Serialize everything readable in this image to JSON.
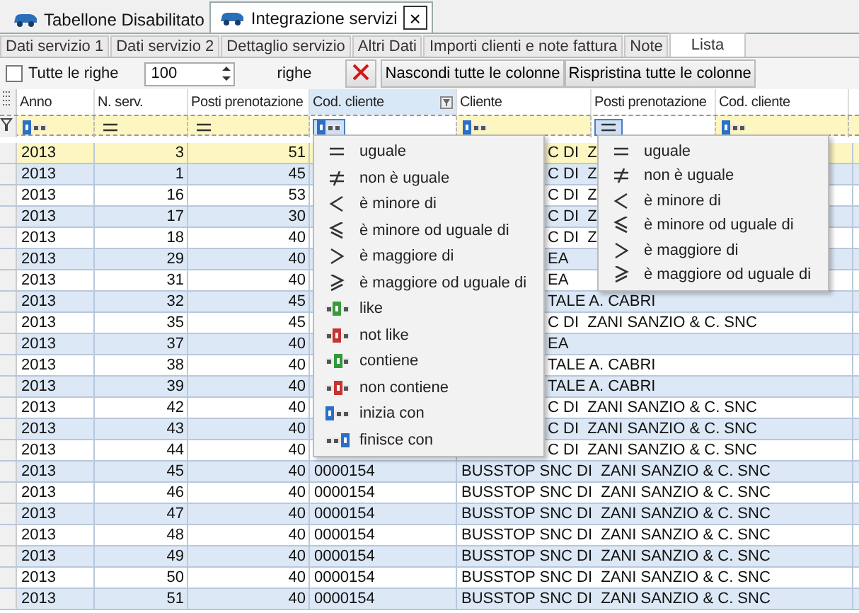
{
  "doc_tabs": [
    {
      "label": "Tabellone Disabilitato",
      "selected": false
    },
    {
      "label": "Integrazione servizi",
      "selected": true,
      "close": "×"
    }
  ],
  "sub_tabs": [
    {
      "label": "Dati servizio 1",
      "selected": false
    },
    {
      "label": "Dati servizio 2",
      "selected": false
    },
    {
      "label": "Dettaglio servizio",
      "selected": false
    },
    {
      "label": "Altri Dati",
      "selected": false
    },
    {
      "label": "Importi clienti e note fattura",
      "selected": false
    },
    {
      "label": "Note",
      "selected": false
    },
    {
      "label": "Lista",
      "selected": true
    }
  ],
  "toolbar": {
    "all_rows": {
      "label": "Tutte le righe",
      "checked": false
    },
    "count": "100",
    "count_unit": "righe",
    "hide_all": "Nascondi tutte le colonne",
    "restore_all": "Rispristina tutte le colonne"
  },
  "columns": [
    {
      "label": "Anno",
      "selected": false,
      "filter": {
        "kind": "starts_with",
        "active": false
      }
    },
    {
      "label": "N. serv.",
      "selected": false,
      "filter": {
        "kind": "equals",
        "active": false
      }
    },
    {
      "label": "Posti prenotazione",
      "selected": false,
      "filter": {
        "kind": "equals",
        "active": false
      }
    },
    {
      "label": "Cod. cliente",
      "selected": true,
      "filter": {
        "kind": "starts_with",
        "active": true
      }
    },
    {
      "label": "Cliente",
      "selected": false,
      "filter": {
        "kind": "starts_with",
        "active": false
      }
    },
    {
      "label": "Posti prenotazione",
      "selected": false,
      "filter": {
        "kind": "equals",
        "active": true
      }
    },
    {
      "label": "Cod. cliente",
      "selected": false,
      "filter": {
        "kind": "starts_with",
        "active": false
      }
    }
  ],
  "rows": [
    {
      "anno": "2013",
      "n_serv": "3",
      "posti": "51",
      "cliente": "C DI  Z",
      "cliente_cut": true,
      "selected": true
    },
    {
      "anno": "2013",
      "n_serv": "1",
      "posti": "45",
      "cliente": "C DI  Z",
      "cliente_cut": true,
      "selected": false
    },
    {
      "anno": "2013",
      "n_serv": "16",
      "posti": "53",
      "cliente": "C DI  Z",
      "cliente_cut": true,
      "selected": false
    },
    {
      "anno": "2013",
      "n_serv": "17",
      "posti": "30",
      "cliente": "C DI  Z",
      "cliente_cut": true,
      "selected": false
    },
    {
      "anno": "2013",
      "n_serv": "18",
      "posti": "40",
      "cliente": "C DI  Z",
      "cliente_cut": true,
      "selected": false
    },
    {
      "anno": "2013",
      "n_serv": "29",
      "posti": "40",
      "cliente": "EA",
      "cliente_cut": true,
      "selected": false
    },
    {
      "anno": "2013",
      "n_serv": "31",
      "posti": "40",
      "cliente": "EA",
      "cliente_cut": true,
      "selected": false
    },
    {
      "anno": "2013",
      "n_serv": "32",
      "posti": "45",
      "cliente": "TALE A. CABRI",
      "cliente_cut": true,
      "selected": false
    },
    {
      "anno": "2013",
      "n_serv": "35",
      "posti": "45",
      "cliente": "C DI  ZANI SANZIO & C. SNC",
      "cliente_cut": true,
      "selected": false
    },
    {
      "anno": "2013",
      "n_serv": "37",
      "posti": "40",
      "cliente": "EA",
      "cliente_cut": true,
      "selected": false
    },
    {
      "anno": "2013",
      "n_serv": "38",
      "posti": "40",
      "cliente": "TALE A. CABRI",
      "cliente_cut": true,
      "selected": false
    },
    {
      "anno": "2013",
      "n_serv": "39",
      "posti": "40",
      "cliente": "TALE A. CABRI",
      "cliente_cut": true,
      "selected": false
    },
    {
      "anno": "2013",
      "n_serv": "42",
      "posti": "40",
      "cliente": "C DI  ZANI SANZIO & C. SNC",
      "cliente_cut": true,
      "selected": false
    },
    {
      "anno": "2013",
      "n_serv": "43",
      "posti": "40",
      "cliente": "C DI  ZANI SANZIO & C. SNC",
      "cliente_cut": true,
      "selected": false
    },
    {
      "anno": "2013",
      "n_serv": "44",
      "posti": "40",
      "cliente": "C DI  ZANI SANZIO & C. SNC",
      "cliente_cut": true,
      "selected": false
    },
    {
      "anno": "2013",
      "n_serv": "45",
      "posti": "40",
      "cod_cliente": "0000154",
      "cliente": "BUSSTOP SNC DI  ZANI SANZIO & C. SNC",
      "cliente_cut": false,
      "selected": false
    },
    {
      "anno": "2013",
      "n_serv": "46",
      "posti": "40",
      "cod_cliente": "0000154",
      "cliente": "BUSSTOP SNC DI  ZANI SANZIO & C. SNC",
      "cliente_cut": false,
      "selected": false
    },
    {
      "anno": "2013",
      "n_serv": "47",
      "posti": "40",
      "cod_cliente": "0000154",
      "cliente": "BUSSTOP SNC DI  ZANI SANZIO & C. SNC",
      "cliente_cut": false,
      "selected": false
    },
    {
      "anno": "2013",
      "n_serv": "48",
      "posti": "40",
      "cod_cliente": "0000154",
      "cliente": "BUSSTOP SNC DI  ZANI SANZIO & C. SNC",
      "cliente_cut": false,
      "selected": false
    },
    {
      "anno": "2013",
      "n_serv": "49",
      "posti": "40",
      "cod_cliente": "0000154",
      "cliente": "BUSSTOP SNC DI  ZANI SANZIO & C. SNC",
      "cliente_cut": false,
      "selected": false
    },
    {
      "anno": "2013",
      "n_serv": "50",
      "posti": "40",
      "cod_cliente": "0000154",
      "cliente": "BUSSTOP SNC DI  ZANI SANZIO & C. SNC",
      "cliente_cut": false,
      "selected": false
    },
    {
      "anno": "2013",
      "n_serv": "51",
      "posti": "40",
      "cod_cliente": "0000154",
      "cliente": "BUSSTOP SNC DI  ZANI SANZIO & C. SNC",
      "cliente_cut": false,
      "selected": false
    }
  ],
  "filter_menus": [
    {
      "items": [
        {
          "kind": "equals",
          "label": "uguale"
        },
        {
          "kind": "not_equal",
          "label": "non è uguale"
        },
        {
          "kind": "less",
          "label": "è minore di"
        },
        {
          "kind": "less_equal",
          "label": "è minore od uguale di"
        },
        {
          "kind": "greater",
          "label": "è maggiore di"
        },
        {
          "kind": "greater_equal",
          "label": "è maggiore od uguale di"
        },
        {
          "kind": "like",
          "label": "like"
        },
        {
          "kind": "not_like",
          "label": "not like"
        },
        {
          "kind": "contains",
          "label": "contiene"
        },
        {
          "kind": "not_contains",
          "label": "non contiene"
        },
        {
          "kind": "starts_with",
          "label": "inizia con"
        },
        {
          "kind": "ends_with",
          "label": "finisce con"
        }
      ]
    },
    {
      "items": [
        {
          "kind": "equals",
          "label": "uguale"
        },
        {
          "kind": "not_equal",
          "label": "non è uguale"
        },
        {
          "kind": "less",
          "label": "è minore di"
        },
        {
          "kind": "less_equal",
          "label": "è minore od uguale di"
        },
        {
          "kind": "greater",
          "label": "è maggiore di"
        },
        {
          "kind": "greater_equal",
          "label": "è maggiore od uguale di"
        }
      ]
    }
  ]
}
